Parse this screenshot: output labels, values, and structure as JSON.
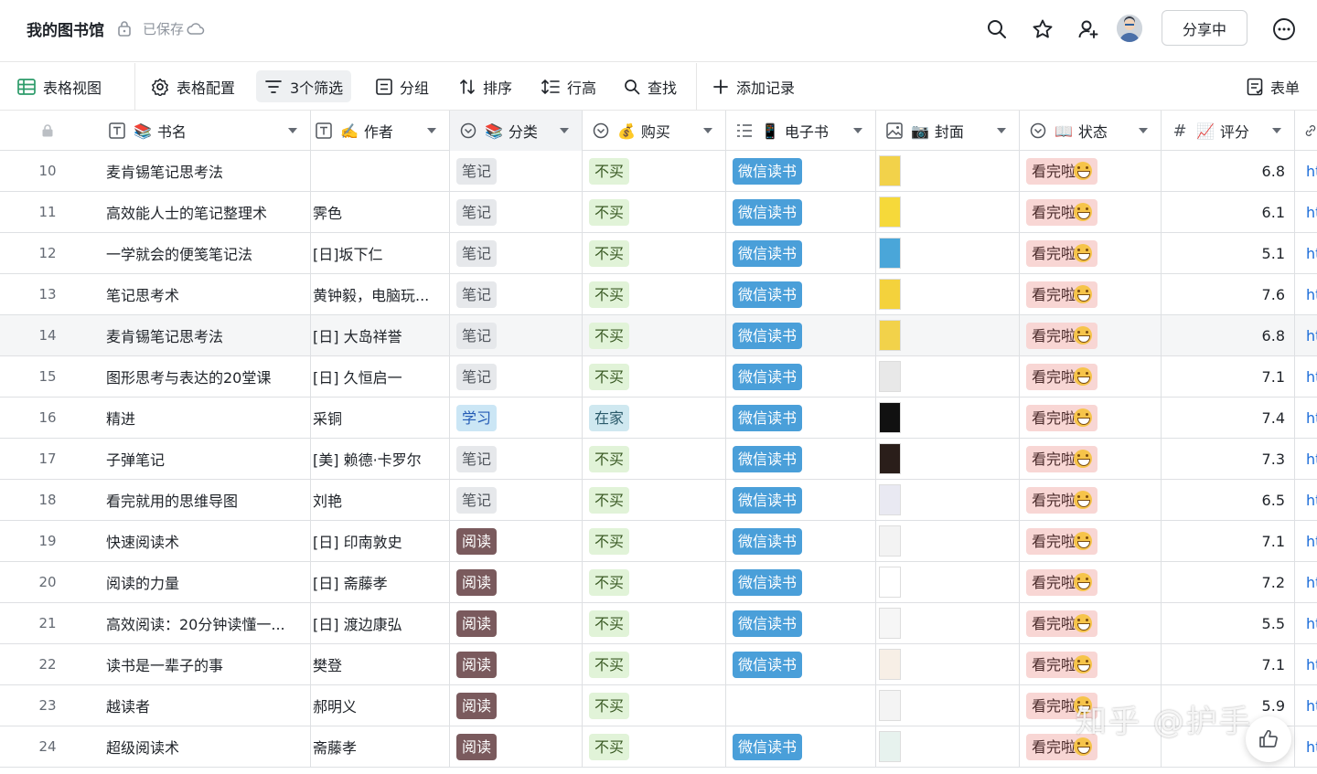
{
  "header": {
    "title": "我的图书馆",
    "saved_text": "已保存",
    "share_label": "分享中"
  },
  "toolbar": {
    "grid_view": "表格视图",
    "table_config": "表格配置",
    "filters": "3个筛选",
    "group": "分组",
    "sort": "排序",
    "row_height": "行高",
    "find": "查找",
    "add_record": "添加记录",
    "form": "表单"
  },
  "columns": {
    "name": "书名",
    "author": "作者",
    "category": "分类",
    "buy": "购买",
    "ebook": "电子书",
    "cover": "封面",
    "status": "状态",
    "score": "评分"
  },
  "column_emoji": {
    "name": "📚",
    "author": "✍️",
    "category": "📚",
    "buy": "💰",
    "ebook": "📱",
    "cover": "📷",
    "status": "📖",
    "score": "📈"
  },
  "rows": [
    {
      "num": "10",
      "name": "麦肯锡笔记思考法",
      "author": "",
      "category": "笔记",
      "buy": "不买",
      "ebook": "微信读书",
      "status": "看完啦",
      "score": "6.8",
      "link": "ht"
    },
    {
      "num": "11",
      "name": "高效能人士的笔记整理术",
      "author": "霁色",
      "category": "笔记",
      "buy": "不买",
      "ebook": "微信读书",
      "status": "看完啦",
      "score": "6.1",
      "link": "ht"
    },
    {
      "num": "12",
      "name": "一学就会的便笺笔记法",
      "author": "[日]坂下仁",
      "category": "笔记",
      "buy": "不买",
      "ebook": "微信读书",
      "status": "看完啦",
      "score": "5.1",
      "link": "ht"
    },
    {
      "num": "13",
      "name": "笔记思考术",
      "author": "黄钟毅，电脑玩...",
      "category": "笔记",
      "buy": "不买",
      "ebook": "微信读书",
      "status": "看完啦",
      "score": "7.6",
      "link": "ht"
    },
    {
      "num": "14",
      "name": "麦肯锡笔记思考法",
      "author": "[日] 大岛祥誉",
      "category": "笔记",
      "buy": "不买",
      "ebook": "微信读书",
      "status": "看完啦",
      "score": "6.8",
      "link": "ht"
    },
    {
      "num": "15",
      "name": "图形思考与表达的20堂课",
      "author": "[日] 久恒启一",
      "category": "笔记",
      "buy": "不买",
      "ebook": "微信读书",
      "status": "看完啦",
      "score": "7.1",
      "link": "ht"
    },
    {
      "num": "16",
      "name": "精进",
      "author": "采铜",
      "category": "学习",
      "buy": "在家",
      "ebook": "微信读书",
      "status": "看完啦",
      "score": "7.4",
      "link": "ht"
    },
    {
      "num": "17",
      "name": "子弹笔记",
      "author": "[美] 赖德·卡罗尔",
      "category": "笔记",
      "buy": "不买",
      "ebook": "微信读书",
      "status": "看完啦",
      "score": "7.3",
      "link": "ht"
    },
    {
      "num": "18",
      "name": "看完就用的思维导图",
      "author": "刘艳",
      "category": "笔记",
      "buy": "不买",
      "ebook": "微信读书",
      "status": "看完啦",
      "score": "6.5",
      "link": "ht"
    },
    {
      "num": "19",
      "name": "快速阅读术",
      "author": "[日] 印南敦史",
      "category": "阅读",
      "buy": "不买",
      "ebook": "微信读书",
      "status": "看完啦",
      "score": "7.1",
      "link": "ht"
    },
    {
      "num": "20",
      "name": "阅读的力量",
      "author": "[日] 斋藤孝",
      "category": "阅读",
      "buy": "不买",
      "ebook": "微信读书",
      "status": "看完啦",
      "score": "7.2",
      "link": "ht"
    },
    {
      "num": "21",
      "name": "高效阅读：20分钟读懂一...",
      "author": "[日] 渡边康弘",
      "category": "阅读",
      "buy": "不买",
      "ebook": "微信读书",
      "status": "看完啦",
      "score": "5.5",
      "link": "ht"
    },
    {
      "num": "22",
      "name": "读书是一辈子的事",
      "author": "樊登",
      "category": "阅读",
      "buy": "不买",
      "ebook": "微信读书",
      "status": "看完啦",
      "score": "7.1",
      "link": "ht"
    },
    {
      "num": "23",
      "name": "越读者",
      "author": "郝明义",
      "category": "阅读",
      "buy": "不买",
      "ebook": "",
      "status": "看完啦",
      "score": "5.9",
      "link": "ht"
    },
    {
      "num": "24",
      "name": "超级阅读术",
      "author": "斋藤孝",
      "category": "阅读",
      "buy": "不买",
      "ebook": "微信读书",
      "status": "看完啦",
      "score": "",
      "link": "ht"
    }
  ],
  "covers": [
    "#f2d24a",
    "#f6d93a",
    "#4aa6d9",
    "#f4d23c",
    "#f2d24a",
    "#e8e8e8",
    "#111111",
    "#2a1e1a",
    "#e9e9f2",
    "#f3f3f3",
    "#ffffff",
    "#f6f6f6",
    "#f7efe6",
    "#f4f4f4",
    "#e7f2ee"
  ],
  "watermark": "知乎 @护手",
  "colors": {
    "accent": "#1b6cd9",
    "tag_note": "#e6e8eb",
    "tag_read": "#7a5a5d",
    "tag_wx": "#4a9fd9",
    "tag_done": "#f8d6d4",
    "tag_nobuy": "#e1f3d8"
  }
}
